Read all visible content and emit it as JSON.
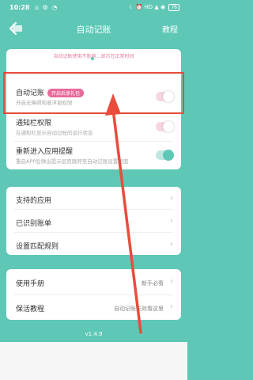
{
  "status_bar": {
    "time": "10:28",
    "left_icons": "⌂ ⚙ ◔",
    "right_icons": "☾ ⏰ HD ▲ ◉",
    "battery": "76"
  },
  "header": {
    "title": "自动记账",
    "tutorial": "教程"
  },
  "banner": {
    "text": "自动记账使用不影响…显示在正常时间"
  },
  "settings": {
    "auto": {
      "title": "自动记账",
      "badge": "开启后享礼包",
      "subtitle": "开启无障碍和悬浮窗权限"
    },
    "notify": {
      "title": "通知栏权限",
      "subtitle": "在通知栏显示自动记账的运行状态"
    },
    "reentry": {
      "title": "重新进入应用提醒",
      "subtitle": "重启APP后弹出提示层而跳转至自动记账设置页面"
    }
  },
  "menu": {
    "supported": "支持的应用",
    "recognized": "已识别账单",
    "rules": "设置匹配规则"
  },
  "help": {
    "manual": "使用手册",
    "manual_extra": "新手必看",
    "keepalive": "保活教程",
    "keepalive_extra": "自动记账失效看这里"
  },
  "version": "v1.4.9",
  "colors": {
    "primary": "#5fc7b6",
    "pink": "#e86a9c",
    "highlight": "#e94c3d"
  },
  "icons": {
    "back": "arrow-left-icon",
    "chevron": "chevron-right-icon"
  }
}
